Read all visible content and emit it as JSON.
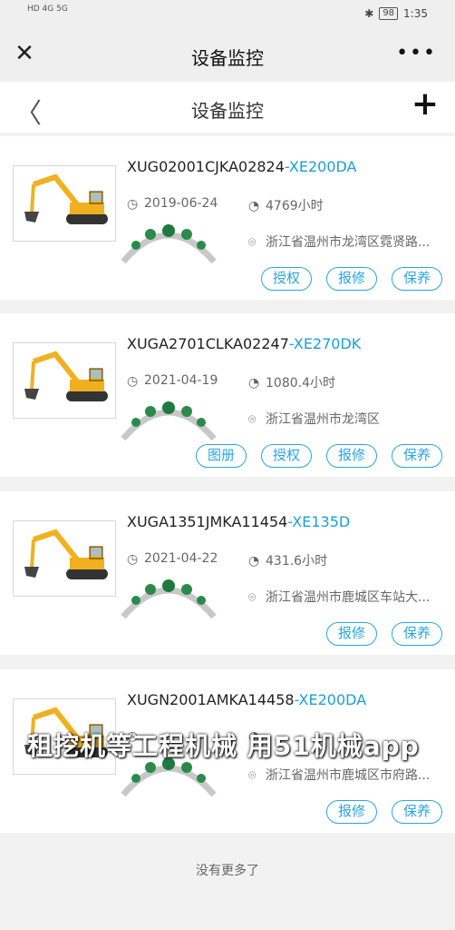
{
  "status": {
    "time": "1:35",
    "battery": "98",
    "signal_left": "HD 4G  5G"
  },
  "wechat_bar": {
    "title": "设备监控"
  },
  "page_bar": {
    "title": "设备监控"
  },
  "equipment": [
    {
      "code": "XUG02001CJKA02824",
      "model": "-XE200DA",
      "date": "2019-06-24",
      "hours": "4769小时",
      "address": "浙江省温州市龙湾区霓贤路...",
      "buttons": [
        "授权",
        "报修",
        "保养"
      ]
    },
    {
      "code": "XUGA2701CLKA02247",
      "model": "-XE270DK",
      "date": "2021-04-19",
      "hours": "1080.4小时",
      "address": "浙江省温州市龙湾区",
      "buttons": [
        "图册",
        "授权",
        "报修",
        "保养"
      ]
    },
    {
      "code": "XUGA1351JMKA11454",
      "model": "-XE135D",
      "date": "2021-04-22",
      "hours": "431.6小时",
      "address": "浙江省温州市鹿城区车站大...",
      "buttons": [
        "报修",
        "保养"
      ]
    },
    {
      "code": "XUGN2001AMKA14458",
      "model": "-XE200DA",
      "date": "",
      "hours": "",
      "address": "浙江省温州市鹿城区市府路...",
      "buttons": [
        "报修",
        "保养"
      ]
    }
  ],
  "footer": {
    "text": "没有更多了"
  },
  "watermark": {
    "text": "租挖机等工程机械 用51机械app"
  },
  "colors": {
    "accent": "#29a6e3",
    "model": "#1aa0d8",
    "excavator": "#f0b020"
  }
}
